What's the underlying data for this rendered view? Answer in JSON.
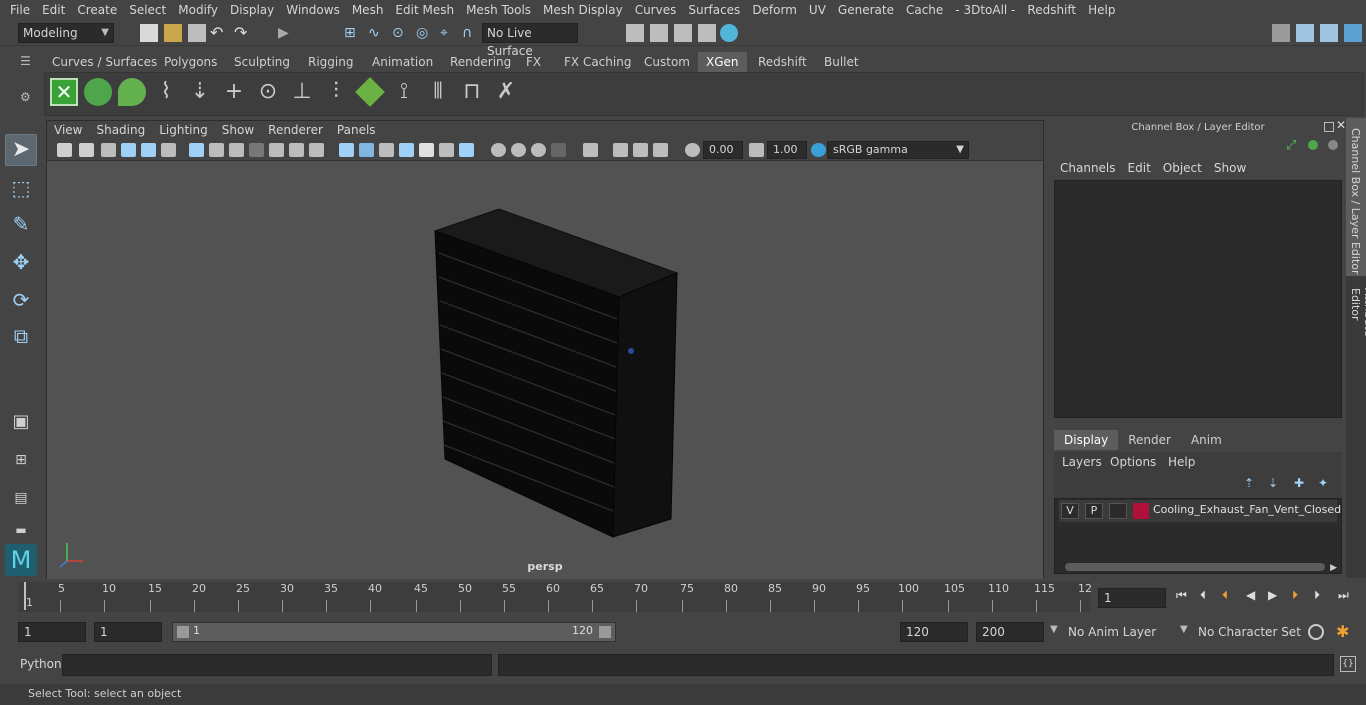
{
  "menubar": {
    "items": [
      "File",
      "Edit",
      "Create",
      "Select",
      "Modify",
      "Display",
      "Windows",
      "Mesh",
      "Edit Mesh",
      "Mesh Tools",
      "Mesh Display",
      "Curves",
      "Surfaces",
      "Deform",
      "UV",
      "Generate",
      "Cache",
      "- 3DtoAll -",
      "Redshift",
      "Help"
    ]
  },
  "statusline": {
    "mode": "Modeling",
    "live_surface": "No Live Surface"
  },
  "shelf": {
    "tabs": [
      "Curves / Surfaces",
      "Polygons",
      "Sculpting",
      "Rigging",
      "Animation",
      "Rendering",
      "FX",
      "FX Caching",
      "Custom",
      "XGen",
      "Redshift",
      "Bullet"
    ],
    "active_tab": "XGen"
  },
  "viewport": {
    "menu": [
      "View",
      "Shading",
      "Lighting",
      "Show",
      "Renderer",
      "Panels"
    ],
    "exposure": "0.00",
    "gamma": "1.00",
    "color_space": "sRGB gamma",
    "camera_label": "persp"
  },
  "right_panel": {
    "title": "Channel Box / Layer Editor",
    "menu": [
      "Channels",
      "Edit",
      "Object",
      "Show"
    ],
    "layer_tabs": [
      "Display",
      "Render",
      "Anim"
    ],
    "active_layer_tab": "Display",
    "layer_menu": [
      "Layers",
      "Options",
      "Help"
    ],
    "layer": {
      "v": "V",
      "p": "P",
      "color": "#b0103a",
      "name": "Cooling_Exhaust_Fan_Vent_Closed"
    },
    "side_tabs": [
      "Channel Box / Layer Editor",
      "Attribute Editor"
    ]
  },
  "timeline": {
    "ticks": [
      "5",
      "10",
      "15",
      "20",
      "25",
      "30",
      "35",
      "40",
      "45",
      "50",
      "55",
      "60",
      "65",
      "70",
      "75",
      "80",
      "85",
      "90",
      "95",
      "100",
      "105",
      "110",
      "115",
      "12"
    ],
    "start_marker": "1",
    "current_frame": "1"
  },
  "range": {
    "start": "1",
    "anim_start": "1",
    "range_start": "1",
    "range_end": "120",
    "end": "120",
    "anim_end": "200",
    "anim_layer": "No Anim Layer",
    "character_set": "No Character Set"
  },
  "command": {
    "language": "Python"
  },
  "help": {
    "text": "Select Tool: select an object"
  }
}
